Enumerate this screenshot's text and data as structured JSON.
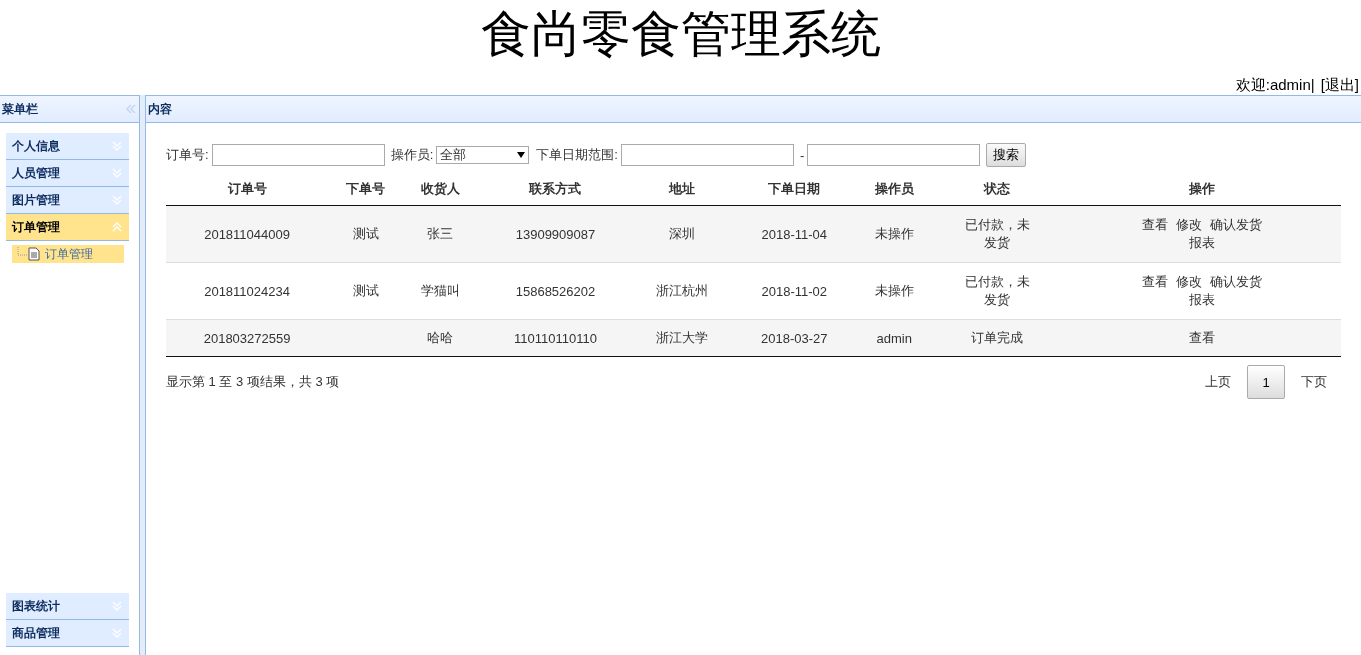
{
  "header": {
    "title": "食尚零食管理系统",
    "welcome": "欢迎:admin|",
    "logout": "[退出]"
  },
  "sidebar": {
    "title": "菜单栏",
    "items": [
      {
        "label": "个人信息",
        "expanded": false
      },
      {
        "label": "人员管理",
        "expanded": false
      },
      {
        "label": "图片管理",
        "expanded": false
      },
      {
        "label": "订单管理",
        "expanded": true,
        "children": [
          {
            "label": "订单管理",
            "selected": true
          }
        ]
      },
      {
        "label": "图表统计",
        "expanded": false
      },
      {
        "label": "商品管理",
        "expanded": false
      }
    ]
  },
  "content": {
    "title": "内容",
    "filters": {
      "order_no_label": "订单号:",
      "operator_label": "操作员:",
      "operator_value": "全部",
      "date_label": "下单日期范围:",
      "date_sep": "-",
      "search_button": "搜索"
    },
    "table": {
      "columns": [
        "订单号",
        "下单号",
        "收货人",
        "联系方式",
        "地址",
        "下单日期",
        "操作员",
        "状态",
        "操作"
      ],
      "rows": [
        {
          "cells": [
            "201811044009",
            "测试",
            "张三",
            "13909909087",
            "深圳",
            "2018-11-04",
            "未操作",
            "已付款，未发货"
          ],
          "actions": [
            "查看",
            "修改",
            "确认发货",
            "报表"
          ]
        },
        {
          "cells": [
            "201811024234",
            "测试",
            "学猫叫",
            "15868526202",
            "浙江杭州",
            "2018-11-02",
            "未操作",
            "已付款，未发货"
          ],
          "actions": [
            "查看",
            "修改",
            "确认发货",
            "报表"
          ]
        },
        {
          "cells": [
            "201803272559",
            "",
            "哈哈",
            "110110110110",
            "浙江大学",
            "2018-03-27",
            "admin",
            "订单完成"
          ],
          "actions": [
            "查看"
          ]
        }
      ]
    },
    "summary": "显示第 1 至 3 项结果，共 3 项",
    "pagination": {
      "prev": "上页",
      "pages": [
        {
          "label": "1",
          "selected": true
        }
      ],
      "next": "下页"
    }
  }
}
